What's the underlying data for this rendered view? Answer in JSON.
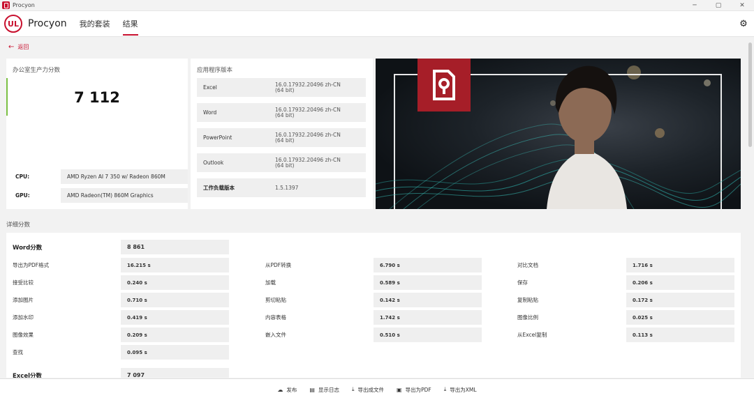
{
  "window": {
    "title": "Procyon",
    "controls": [
      "─",
      "▢",
      "✕"
    ]
  },
  "nav": {
    "brand": "Procyon",
    "logo_text": "UL",
    "tabs": [
      {
        "label": "我的套装"
      },
      {
        "label": "结果"
      }
    ],
    "active_tab": "结果"
  },
  "back": {
    "label": "返回"
  },
  "score_card": {
    "heading": "办公室生产力分数",
    "score": "7 112",
    "cpu_label": "CPU:",
    "cpu_value": "AMD Ryzen AI 7 350 w/ Radeon 860M",
    "gpu_label": "GPU:",
    "gpu_value": "AMD Radeon(TM) 860M Graphics"
  },
  "versions_card": {
    "heading": "应用程序版本",
    "rows": [
      {
        "name": "Excel",
        "version_line1": "16.0.17932.20496 zh-CN",
        "version_line2": "(64 bit)"
      },
      {
        "name": "Word",
        "version_line1": "16.0.17932.20496 zh-CN",
        "version_line2": "(64 bit)"
      },
      {
        "name": "PowerPoint",
        "version_line1": "16.0.17932.20496 zh-CN",
        "version_line2": "(64 bit)"
      },
      {
        "name": "Outlook",
        "version_line1": "16.0.17932.20496 zh-CN",
        "version_line2": "(64 bit)"
      },
      {
        "name": "工作负载版本",
        "version_line1": "1.5.1397",
        "version_line2": ""
      }
    ]
  },
  "details": {
    "title": "详细分数",
    "word_heading": {
      "label": "Word分数",
      "value": "8 861"
    },
    "rows": [
      [
        {
          "label": "导出为PDF格式",
          "value": "16.215 s"
        },
        {
          "label": "从PDF转换",
          "value": "6.790 s"
        },
        {
          "label": "对比文档",
          "value": "1.716 s"
        }
      ],
      [
        {
          "label": "接受比较",
          "value": "0.240 s"
        },
        {
          "label": "加载",
          "value": "0.589 s"
        },
        {
          "label": "保存",
          "value": "0.206 s"
        }
      ],
      [
        {
          "label": "添加图片",
          "value": "0.710 s"
        },
        {
          "label": "剪切粘贴",
          "value": "0.142 s"
        },
        {
          "label": "复制粘贴",
          "value": "0.172 s"
        }
      ],
      [
        {
          "label": "添加水印",
          "value": "0.419 s"
        },
        {
          "label": "内容表格",
          "value": "1.742 s"
        },
        {
          "label": "图像比例",
          "value": "0.025 s"
        }
      ],
      [
        {
          "label": "图像效果",
          "value": "0.209 s"
        },
        {
          "label": "嵌入文件",
          "value": "0.510 s"
        },
        {
          "label": "从Excel复制",
          "value": "0.113 s"
        }
      ],
      [
        {
          "label": "查找",
          "value": "0.095 s"
        }
      ]
    ],
    "excel_heading": {
      "label": "Excel分数",
      "value": "7 097"
    }
  },
  "bottom_toolbar": [
    {
      "icon": "cloud-upload-icon",
      "label": "发布"
    },
    {
      "icon": "document-icon",
      "label": "显示日志"
    },
    {
      "icon": "download-icon",
      "label": "导出成文件"
    },
    {
      "icon": "save-icon",
      "label": "导出为PDF"
    },
    {
      "icon": "download-icon",
      "label": "导出为XML"
    }
  ],
  "colors": {
    "accent_red": "#c8102e",
    "score_accent_green": "#7bc043",
    "hero_badge": "#a61e28"
  }
}
